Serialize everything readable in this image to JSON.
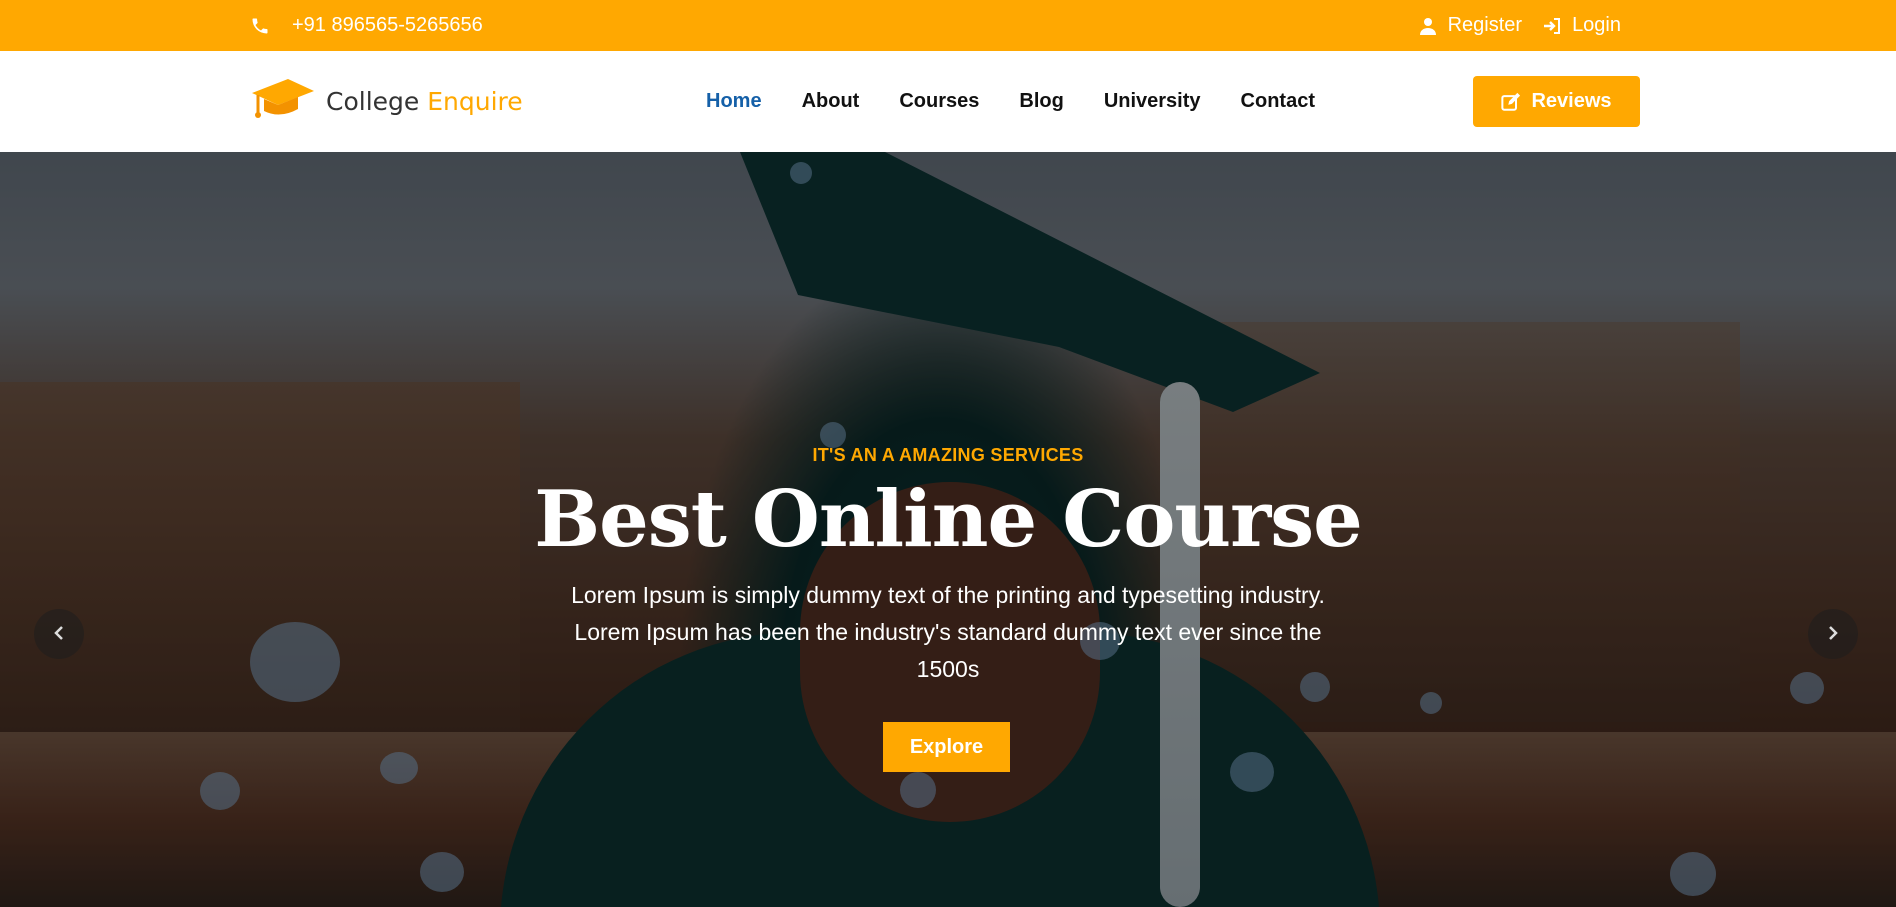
{
  "topbar": {
    "phone_icon": "phone-icon",
    "phone": "+91 896565-5265656",
    "register_icon": "user-icon",
    "register": "Register",
    "login_icon": "sign-in-icon",
    "login": "Login"
  },
  "logo": {
    "icon": "graduation-cap-icon",
    "brand_main": "College",
    "brand_accent": "Enquire"
  },
  "nav": {
    "items": [
      {
        "label": "Home",
        "active": true
      },
      {
        "label": "About"
      },
      {
        "label": "Courses"
      },
      {
        "label": "Blog"
      },
      {
        "label": "University"
      },
      {
        "label": "Contact"
      }
    ],
    "reviews_icon": "edit-icon",
    "reviews": "Reviews"
  },
  "hero": {
    "eyebrow": "IT'S AN A AMAZING SERVICES",
    "title": "Best Online Course",
    "description": "Lorem Ipsum is simply dummy text of the printing and typesetting industry. Lorem Ipsum has been the industry's standard dummy text ever since the 1500s",
    "cta": "Explore",
    "prev_icon": "chevron-left-icon",
    "next_icon": "chevron-right-icon"
  },
  "colors": {
    "accent": "#ffa801",
    "nav_active": "#1560a8"
  }
}
